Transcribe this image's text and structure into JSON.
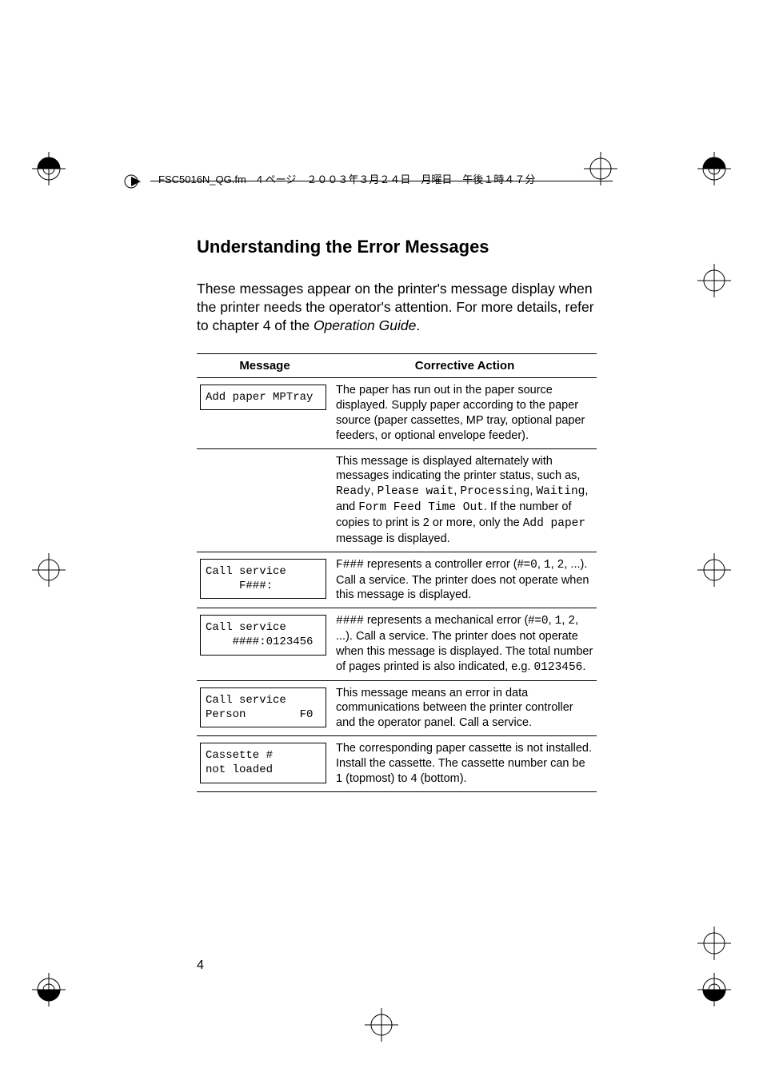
{
  "header": {
    "text": "FSC5016N_QG.fm　4 ページ　２００３年３月２４日　月曜日　午後１時４７分"
  },
  "heading": "Understanding the Error Messages",
  "intro": {
    "line1": "These messages appear on the printer's message display when the printer needs the operator's attention. For more details, refer to chapter 4 of the ",
    "italic": "Operation Guide",
    "line2": "."
  },
  "table": {
    "col_message": "Message",
    "col_action": "Corrective Action",
    "rows": [
      {
        "msg": "Add paper MPTray",
        "action_pre": "The paper has run out in the paper source displayed. Supply paper according to the paper source (paper cassettes, MP tray, optional paper feeders, or optional envelope feeder)."
      },
      {
        "msg": "",
        "action_pre": "This message is displayed alternately with messages indicating the printer status, such as, ",
        "mono1": "Ready",
        "sep1": ", ",
        "mono2": "Please wait",
        "sep2": ", ",
        "mono3": "Processing",
        "sep3": ", ",
        "mono4": "Waiting",
        "sep4": ", and ",
        "mono5": "Form Feed Time Out",
        "mid": ". If the number of copies to print is 2 or more, only the ",
        "mono6": "Add paper",
        "post": " message is displayed."
      },
      {
        "msg": "Call service\n     F###:",
        "mono1": "F###",
        "pre": " represents a controller error (#=",
        "mono2": "0",
        "s1": ", ",
        "mono3": "1",
        "s2": ", ",
        "mono4": "2",
        "post": ", ...). Call a service. The printer does not operate when this message is displayed."
      },
      {
        "msg": "Call service\n    ####:0123456",
        "mono1": "####",
        "pre": " represents a mechanical error (#=",
        "mono2": "0",
        "s1": ", ",
        "mono3": "1",
        "s2": ", ",
        "mono4": "2",
        "mid": ", ...). Call a service. The printer does not operate when this message is displayed. The total number of pages printed is also indicated, e.g. ",
        "mono5": "0123456",
        "post": "."
      },
      {
        "msg": "Call service\nPerson        F0",
        "action_pre": "This message means an error in data communications between the printer controller and the operator panel. Call a service."
      },
      {
        "msg": "Cassette #\nnot loaded",
        "action_pre": "The corresponding paper cassette is not installed. Install the cassette. The cassette number can be 1 (topmost) to 4 (bottom)."
      }
    ]
  },
  "page_number": "4"
}
